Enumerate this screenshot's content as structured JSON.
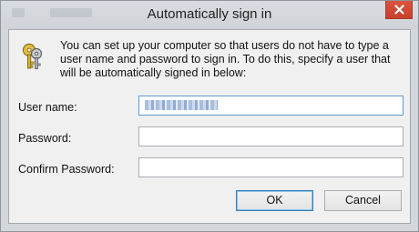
{
  "dialog": {
    "title": "Automatically sign in",
    "message": "You can set up your computer so that users do not have to type a user name and password to sign in. To do this, specify a user that will be automatically signed in below:",
    "fields": [
      {
        "label": "User name:",
        "value": ""
      },
      {
        "label": "Password:",
        "value": ""
      },
      {
        "label": "Confirm Password:",
        "value": ""
      }
    ],
    "buttons": {
      "ok": "OK",
      "cancel": "Cancel"
    }
  },
  "icons": {
    "close": "close-icon",
    "keys": "keys-icon"
  },
  "colors": {
    "close_button": "#c7402d",
    "default_button_border": "#3c7fb1"
  }
}
